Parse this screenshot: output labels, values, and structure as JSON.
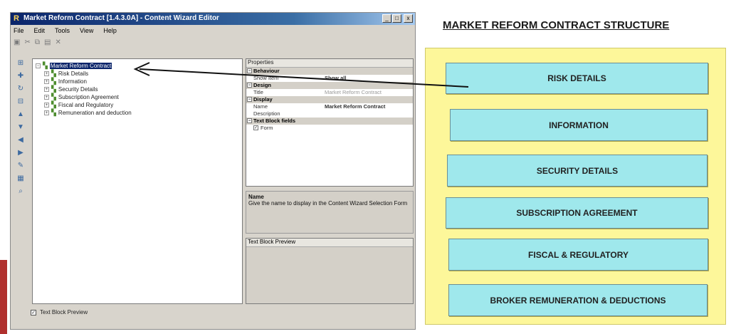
{
  "window": {
    "title": "Market Reform Contract [1.4.3.0A] - Content Wizard Editor",
    "app_icon": "R",
    "controls": [
      "_",
      "□",
      "x"
    ]
  },
  "menu": [
    "File",
    "Edit",
    "Tools",
    "View",
    "Help"
  ],
  "toolbar_icons": [
    "save-icon",
    "cut-icon",
    "copy-icon",
    "paste-icon",
    "delete-icon"
  ],
  "tree": {
    "root": "Market Reform Contract",
    "children": [
      "Risk Details",
      "Information",
      "Security Details",
      "Subscription Agreement",
      "Fiscal and Regulatory",
      "Remuneration and deduction"
    ]
  },
  "properties": {
    "header": "Properties",
    "rows": [
      {
        "type": "cat",
        "label": "Behaviour"
      },
      {
        "type": "prop",
        "key": "Show Item",
        "value": "Show all",
        "dim": false
      },
      {
        "type": "cat",
        "label": "Design"
      },
      {
        "type": "prop",
        "key": "Title",
        "value": "Market Reform Contract",
        "dim": true
      },
      {
        "type": "cat",
        "label": "Display"
      },
      {
        "type": "prop",
        "key": "Name",
        "value": "Market Reform Contract",
        "dim": false
      },
      {
        "type": "prop",
        "key": "Description",
        "value": "",
        "dim": false
      },
      {
        "type": "cat",
        "label": "Text Block fields"
      },
      {
        "type": "prop",
        "key": "Form",
        "value": "",
        "dim": false
      }
    ]
  },
  "description": {
    "name": "Name",
    "text": "Give the name to display in the Content Wizard Selection Form"
  },
  "preview": {
    "header": "Text Block Preview"
  },
  "status": {
    "checkbox_label": "Text Block Preview",
    "checked": true
  },
  "diagram": {
    "title": "MARKET REFORM CONTRACT STRUCTURE",
    "boxes": [
      "RISK DETAILS",
      "INFORMATION",
      "SECURITY DETAILS",
      "SUBSCRIPTION AGREEMENT",
      "FISCAL & REGULATORY",
      "BROKER REMUNERATION & DEDUCTIONS"
    ],
    "panel_color": "#fdf79a",
    "box_color": "#9fe8ec"
  }
}
